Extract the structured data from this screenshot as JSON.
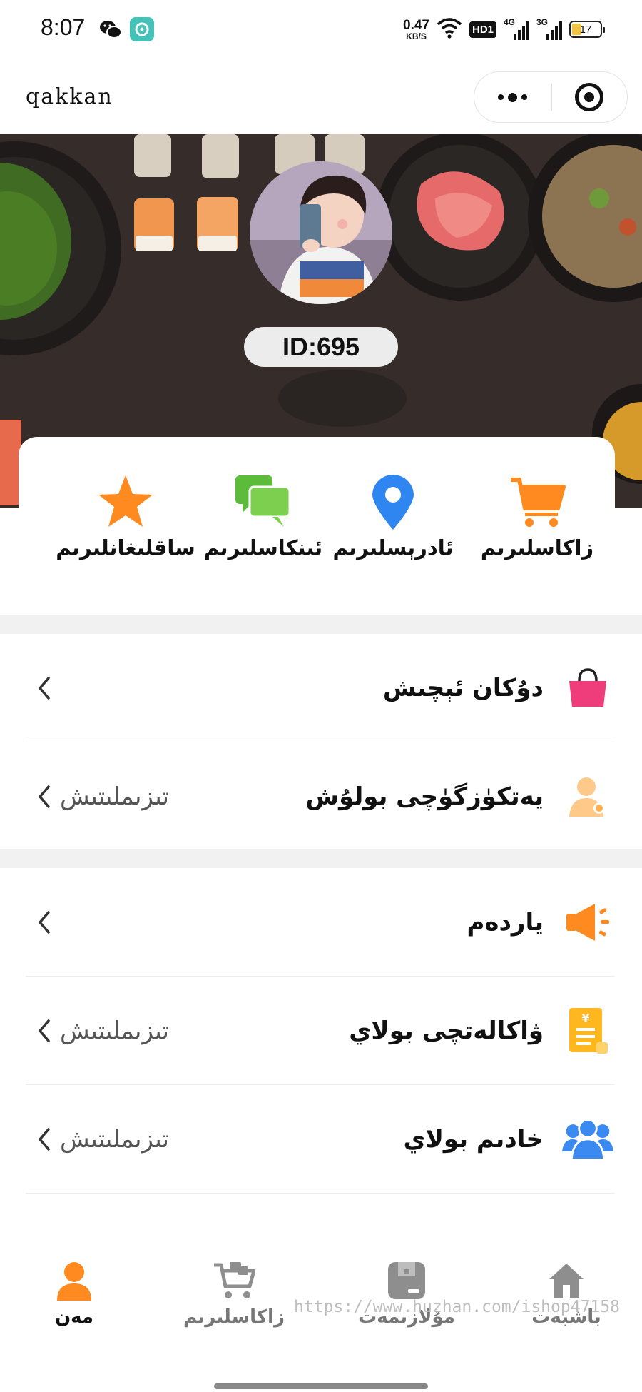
{
  "status_bar": {
    "time": "8:07",
    "net_speed_value": "0.47",
    "net_speed_unit": "KB/S",
    "hd_label": "HD1",
    "signal1_label": "4G",
    "signal2_label": "3G",
    "battery_level": "17"
  },
  "nav": {
    "title": "qakkan"
  },
  "profile": {
    "id_label": "ID:695"
  },
  "quick_actions": [
    {
      "label": "زاكاسلىرىم",
      "icon": "cart-icon"
    },
    {
      "label": "ئادرېسلىرىم",
      "icon": "location-pin-icon"
    },
    {
      "label": "ئىنكاسلىرىم",
      "icon": "chat-bubbles-icon"
    },
    {
      "label": "ساقلىغانلىرىم",
      "icon": "star-icon"
    }
  ],
  "section1": [
    {
      "title": "دۇكان ئېچىش",
      "hint": "",
      "icon": "handbag-icon"
    },
    {
      "title": "يەتكۈزگۈچى بولۇش",
      "hint": "تىزىملىتىش",
      "icon": "courier-user-icon"
    }
  ],
  "section2": [
    {
      "title": "ياردەم",
      "hint": "",
      "icon": "megaphone-icon"
    },
    {
      "title": "ۋاكالەتچى بولاي",
      "hint": "تىزىملىتىش",
      "icon": "agent-document-icon"
    },
    {
      "title": "خادىم بولاي",
      "hint": "تىزىملىتىش",
      "icon": "staff-group-icon"
    }
  ],
  "tabs": [
    {
      "label": "مەن",
      "icon": "user-icon",
      "active": true
    },
    {
      "label": "زاكاسلىرىم",
      "icon": "cart-icon",
      "active": false
    },
    {
      "label": "مۇلازىمەت",
      "icon": "service-box-icon",
      "active": false
    },
    {
      "label": "باشبەت",
      "icon": "home-icon",
      "active": false
    }
  ],
  "watermark": "https://www.huzhan.com/ishop47158",
  "colors": {
    "accent_orange": "#ff8a1f",
    "tab_active": "#ff8a1f",
    "tab_inactive": "#8e8e8e",
    "pink": "#ee3d7a",
    "blue": "#2f7ef0",
    "green": "#5dbb3c"
  }
}
